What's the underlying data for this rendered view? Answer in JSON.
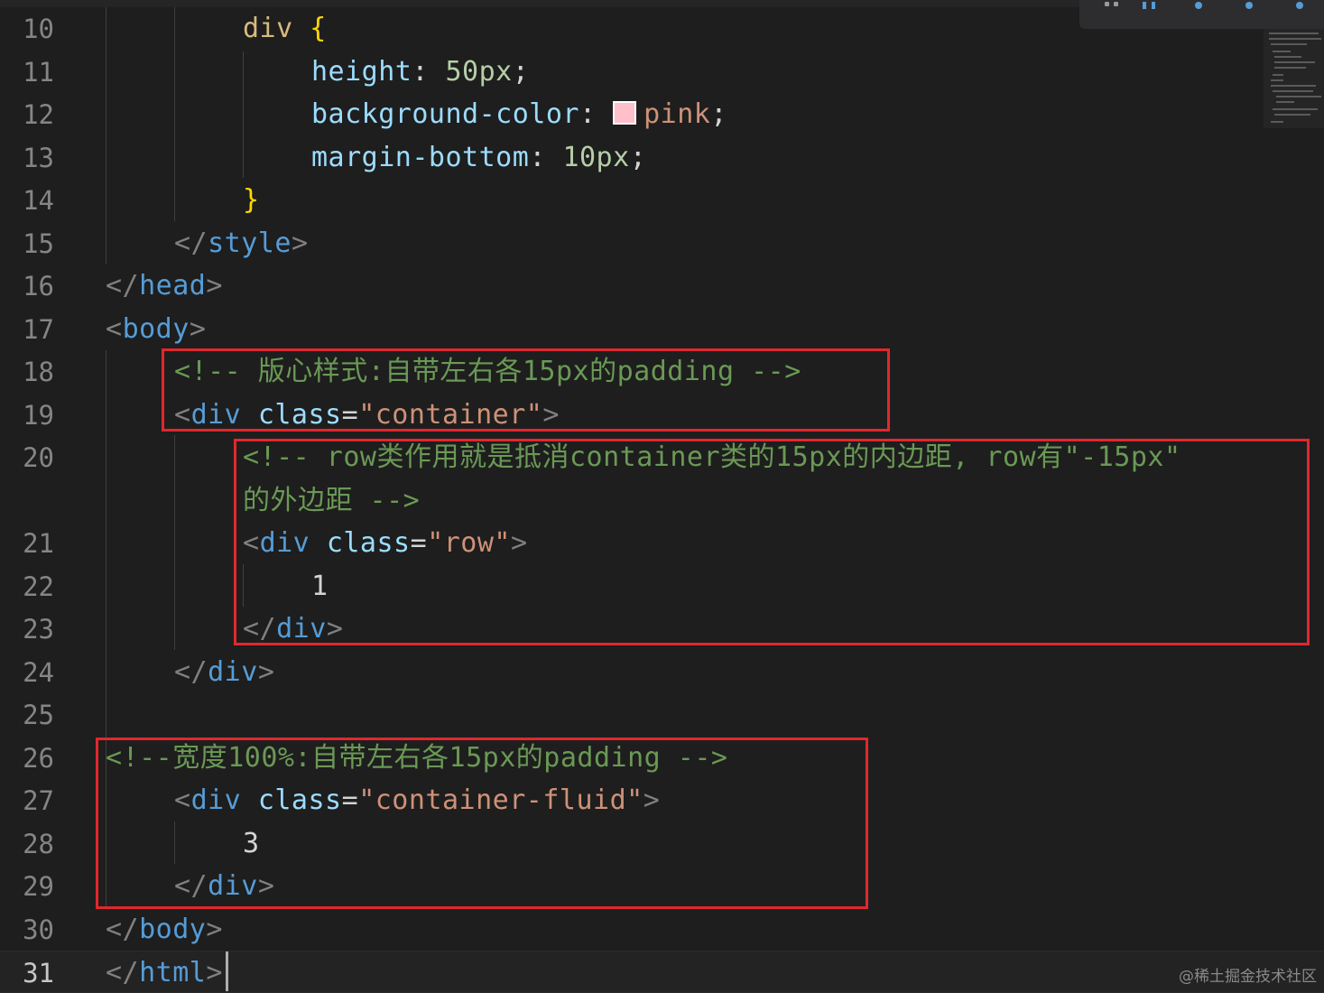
{
  "editor": {
    "current_line": "31"
  },
  "lines": [
    {
      "num": "10",
      "tokens": [
        [
          "t-sel",
          "div"
        ],
        [
          "t-text",
          " "
        ],
        [
          "t-brace",
          "{"
        ]
      ]
    },
    {
      "num": "11",
      "tokens": [
        [
          "t-prop",
          "height"
        ],
        [
          "t-text",
          ": "
        ],
        [
          "t-num",
          "50px"
        ],
        [
          "t-text",
          ";"
        ]
      ]
    },
    {
      "num": "12",
      "tokens": [
        [
          "t-prop",
          "background-color"
        ],
        [
          "t-text",
          ": "
        ],
        [
          "swatch",
          ""
        ],
        [
          "t-val",
          "pink"
        ],
        [
          "t-text",
          ";"
        ]
      ]
    },
    {
      "num": "13",
      "tokens": [
        [
          "t-prop",
          "margin-bottom"
        ],
        [
          "t-text",
          ": "
        ],
        [
          "t-num",
          "10px"
        ],
        [
          "t-text",
          ";"
        ]
      ]
    },
    {
      "num": "14",
      "tokens": [
        [
          "t-brace",
          "}"
        ]
      ]
    },
    {
      "num": "15",
      "tokens": [
        [
          "t-punct",
          "</"
        ],
        [
          "t-tag",
          "style"
        ],
        [
          "t-punct",
          ">"
        ]
      ]
    },
    {
      "num": "16",
      "tokens": [
        [
          "t-punct",
          "</"
        ],
        [
          "t-tag",
          "head"
        ],
        [
          "t-punct",
          ">"
        ]
      ]
    },
    {
      "num": "17",
      "tokens": [
        [
          "t-punct",
          "<"
        ],
        [
          "t-tag",
          "body"
        ],
        [
          "t-punct",
          ">"
        ]
      ]
    },
    {
      "num": "18",
      "tokens": [
        [
          "t-comment",
          "<!-- 版心样式:自带左右各15px的padding -->"
        ]
      ]
    },
    {
      "num": "19",
      "tokens": [
        [
          "t-punct",
          "<"
        ],
        [
          "t-tag",
          "div"
        ],
        [
          "t-text",
          " "
        ],
        [
          "t-attr",
          "class"
        ],
        [
          "t-text",
          "="
        ],
        [
          "t-str",
          "\"container\""
        ],
        [
          "t-punct",
          ">"
        ]
      ]
    },
    {
      "num": "20",
      "tokens": [
        [
          "t-comment",
          "<!-- row类作用就是抵消container类的15px的内边距, row有\"-15px\""
        ]
      ]
    },
    {
      "num": "",
      "tokens": [
        [
          "t-comment",
          "的外边距 -->"
        ]
      ]
    },
    {
      "num": "21",
      "tokens": [
        [
          "t-punct",
          "<"
        ],
        [
          "t-tag",
          "div"
        ],
        [
          "t-text",
          " "
        ],
        [
          "t-attr",
          "class"
        ],
        [
          "t-text",
          "="
        ],
        [
          "t-str",
          "\"row\""
        ],
        [
          "t-punct",
          ">"
        ]
      ]
    },
    {
      "num": "22",
      "tokens": [
        [
          "t-text",
          "1"
        ]
      ]
    },
    {
      "num": "23",
      "tokens": [
        [
          "t-punct",
          "</"
        ],
        [
          "t-tag",
          "div"
        ],
        [
          "t-punct",
          ">"
        ]
      ]
    },
    {
      "num": "24",
      "tokens": [
        [
          "t-punct",
          "</"
        ],
        [
          "t-tag",
          "div"
        ],
        [
          "t-punct",
          ">"
        ]
      ]
    },
    {
      "num": "25",
      "tokens": []
    },
    {
      "num": "26",
      "tokens": [
        [
          "t-comment",
          "<!--宽度100%:自带左右各15px的padding -->"
        ]
      ]
    },
    {
      "num": "27",
      "tokens": [
        [
          "t-punct",
          "<"
        ],
        [
          "t-tag",
          "div"
        ],
        [
          "t-text",
          " "
        ],
        [
          "t-attr",
          "class"
        ],
        [
          "t-text",
          "="
        ],
        [
          "t-str",
          "\"container-fluid\""
        ],
        [
          "t-punct",
          ">"
        ]
      ]
    },
    {
      "num": "28",
      "tokens": [
        [
          "t-text",
          "3"
        ]
      ]
    },
    {
      "num": "29",
      "tokens": [
        [
          "t-punct",
          "</"
        ],
        [
          "t-tag",
          "div"
        ],
        [
          "t-punct",
          ">"
        ]
      ]
    },
    {
      "num": "30",
      "tokens": [
        [
          "t-punct",
          "</"
        ],
        [
          "t-tag",
          "body"
        ],
        [
          "t-punct",
          ">"
        ]
      ]
    },
    {
      "num": "31",
      "tokens": [
        [
          "t-punct",
          "</"
        ],
        [
          "t-tag",
          "html"
        ],
        [
          "t-punct",
          ">"
        ]
      ]
    }
  ],
  "colors": {
    "swatch_pink": "#ffc0cb",
    "highlight_box": "#e0282e"
  },
  "watermark": "@稀土掘金技术社区"
}
